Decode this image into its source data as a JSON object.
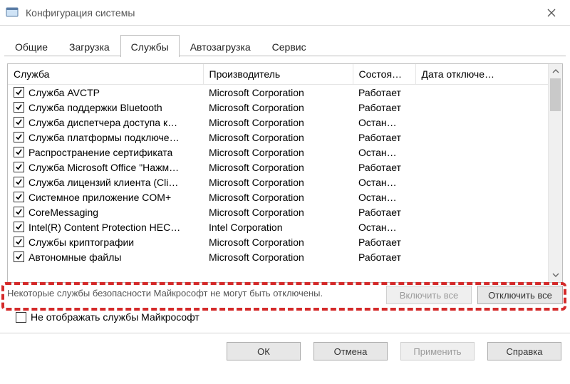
{
  "window": {
    "title": "Конфигурация системы"
  },
  "tabs": {
    "items": [
      {
        "label": "Общие"
      },
      {
        "label": "Загрузка"
      },
      {
        "label": "Службы"
      },
      {
        "label": "Автозагрузка"
      },
      {
        "label": "Сервис"
      }
    ],
    "activeIndex": 2
  },
  "columns": {
    "service": "Служба",
    "vendor": "Производитель",
    "state": "Состоя…",
    "disabledDate": "Дата отключе…"
  },
  "rows": [
    {
      "checked": true,
      "name": "Служба AVCTP",
      "vendor": "Microsoft Corporation",
      "state": "Работает"
    },
    {
      "checked": true,
      "name": "Служба поддержки Bluetooth",
      "vendor": "Microsoft Corporation",
      "state": "Работает"
    },
    {
      "checked": true,
      "name": "Служба диспетчера доступа к…",
      "vendor": "Microsoft Corporation",
      "state": "Остан…"
    },
    {
      "checked": true,
      "name": "Служба платформы подключе…",
      "vendor": "Microsoft Corporation",
      "state": "Работает"
    },
    {
      "checked": true,
      "name": "Распространение сертификата",
      "vendor": "Microsoft Corporation",
      "state": "Остан…"
    },
    {
      "checked": true,
      "name": "Служба Microsoft Office \"Нажм…",
      "vendor": "Microsoft Corporation",
      "state": "Работает"
    },
    {
      "checked": true,
      "name": "Служба лицензий клиента (Cli…",
      "vendor": "Microsoft Corporation",
      "state": "Остан…"
    },
    {
      "checked": true,
      "name": "Системное приложение COM+",
      "vendor": "Microsoft Corporation",
      "state": "Остан…"
    },
    {
      "checked": true,
      "name": "CoreMessaging",
      "vendor": "Microsoft Corporation",
      "state": "Работает"
    },
    {
      "checked": true,
      "name": "Intel(R) Content Protection HEC…",
      "vendor": "Intel Corporation",
      "state": "Остан…"
    },
    {
      "checked": true,
      "name": "Службы криптографии",
      "vendor": "Microsoft Corporation",
      "state": "Работает"
    },
    {
      "checked": true,
      "name": "Автономные файлы",
      "vendor": "Microsoft Corporation",
      "state": "Работает"
    }
  ],
  "note": "Некоторые службы безопасности Майкрософт не могут быть отключены.",
  "buttons": {
    "enableAll": "Включить все",
    "disableAll": "Отключить все"
  },
  "hideMs": {
    "checked": false,
    "label": "Не отображать службы Майкрософт"
  },
  "footer": {
    "ok": "ОК",
    "cancel": "Отмена",
    "apply": "Применить",
    "help": "Справка"
  }
}
